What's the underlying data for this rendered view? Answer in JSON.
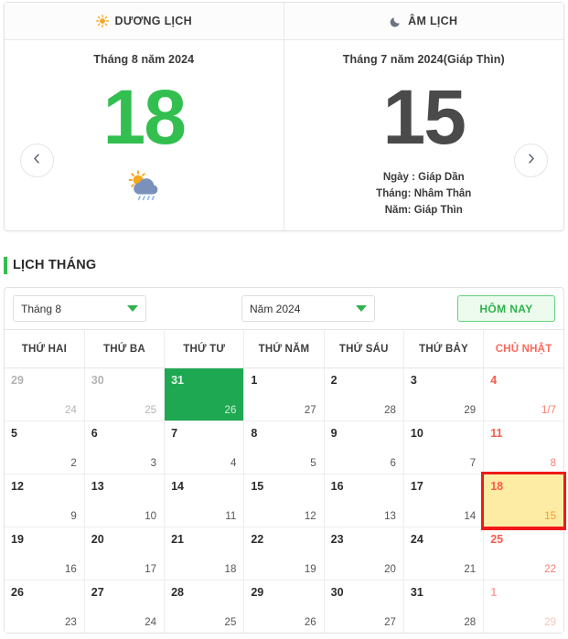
{
  "tabs": [
    {
      "label": "DƯƠNG LỊCH",
      "icon": "sun-icon"
    },
    {
      "label": "ÂM LỊCH",
      "icon": "moon-icon"
    }
  ],
  "solar": {
    "heading": "Tháng 8 năm 2024",
    "day": "18",
    "weather_icon": "sun-cloud-rain-icon",
    "color": "#33bf4f"
  },
  "lunar": {
    "heading": "Tháng 7 năm 2024(Giáp Thìn)",
    "day": "15",
    "day_canchi": "Ngày : Giáp Dần",
    "month_canchi": "Tháng: Nhâm Thân",
    "year_canchi": "Năm: Giáp Thìn",
    "color": "#4a4a4a"
  },
  "nav": {
    "prev_icon": "chevron-left-icon",
    "next_icon": "chevron-right-icon"
  },
  "section": {
    "title": "LỊCH THÁNG",
    "accent": "#33bf4f"
  },
  "controls": {
    "month_value": "Tháng 8",
    "year_value": "Năm 2024",
    "today_label": "HÔM NAY",
    "caret_icon": "chevron-down-icon"
  },
  "calendar": {
    "weekdays": [
      "THỨ HAI",
      "THỨ BA",
      "THỨ TƯ",
      "THỨ NĂM",
      "THỨ SÁU",
      "THỨ BẢY",
      "CHỦ NHẬT"
    ],
    "rows": [
      [
        {
          "solar": "29",
          "lunar": "24",
          "other": true
        },
        {
          "solar": "30",
          "lunar": "25",
          "other": true
        },
        {
          "solar": "31",
          "lunar": "26",
          "other": true,
          "green": true
        },
        {
          "solar": "1",
          "lunar": "27"
        },
        {
          "solar": "2",
          "lunar": "28"
        },
        {
          "solar": "3",
          "lunar": "29"
        },
        {
          "solar": "4",
          "lunar": "1/7",
          "sunday": true
        }
      ],
      [
        {
          "solar": "5",
          "lunar": "2"
        },
        {
          "solar": "6",
          "lunar": "3"
        },
        {
          "solar": "7",
          "lunar": "4"
        },
        {
          "solar": "8",
          "lunar": "5"
        },
        {
          "solar": "9",
          "lunar": "6"
        },
        {
          "solar": "10",
          "lunar": "7"
        },
        {
          "solar": "11",
          "lunar": "8",
          "sunday": true
        }
      ],
      [
        {
          "solar": "12",
          "lunar": "9"
        },
        {
          "solar": "13",
          "lunar": "10"
        },
        {
          "solar": "14",
          "lunar": "11"
        },
        {
          "solar": "15",
          "lunar": "12"
        },
        {
          "solar": "16",
          "lunar": "13"
        },
        {
          "solar": "17",
          "lunar": "14"
        },
        {
          "solar": "18",
          "lunar": "15",
          "sunday": true,
          "selected": true
        }
      ],
      [
        {
          "solar": "19",
          "lunar": "16"
        },
        {
          "solar": "20",
          "lunar": "17"
        },
        {
          "solar": "21",
          "lunar": "18"
        },
        {
          "solar": "22",
          "lunar": "19"
        },
        {
          "solar": "23",
          "lunar": "20"
        },
        {
          "solar": "24",
          "lunar": "21"
        },
        {
          "solar": "25",
          "lunar": "22",
          "sunday": true
        }
      ],
      [
        {
          "solar": "26",
          "lunar": "23"
        },
        {
          "solar": "27",
          "lunar": "24"
        },
        {
          "solar": "28",
          "lunar": "25"
        },
        {
          "solar": "29",
          "lunar": "26"
        },
        {
          "solar": "30",
          "lunar": "27"
        },
        {
          "solar": "31",
          "lunar": "28"
        },
        {
          "solar": "1",
          "lunar": "29",
          "sunday": true,
          "other": true
        }
      ]
    ]
  }
}
